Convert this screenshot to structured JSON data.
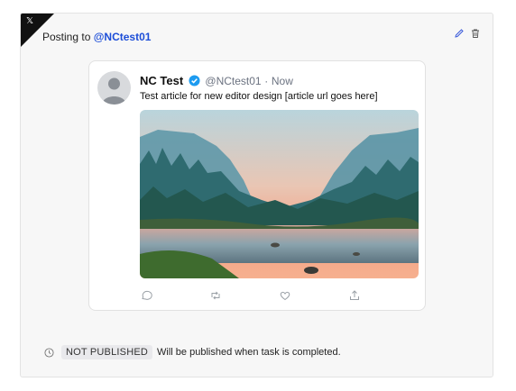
{
  "platform": {
    "icon": "x-logo-icon",
    "glyph": "𝕏"
  },
  "header": {
    "posting_prefix": "Posting to ",
    "posting_handle": "@NCtest01",
    "edit_icon": "pencil-icon",
    "delete_icon": "trash-icon"
  },
  "tweet": {
    "name": "NC Test",
    "handle": "@NCtest01",
    "separator": "·",
    "time": "Now",
    "text": "Test article for new editor design [article url goes here]",
    "verified_icon": "verified-badge-icon",
    "image": "landscape-valley-river-image",
    "actions": [
      "reply-icon",
      "retweet-icon",
      "like-icon",
      "share-icon"
    ]
  },
  "status": {
    "icon": "clock-icon",
    "badge": "NOT PUBLISHED",
    "message": "Will be published when task is completed."
  },
  "colors": {
    "accent_link": "#1d4ed8",
    "verified": "#1d9bf0",
    "card_bg": "#f7f7f7"
  }
}
